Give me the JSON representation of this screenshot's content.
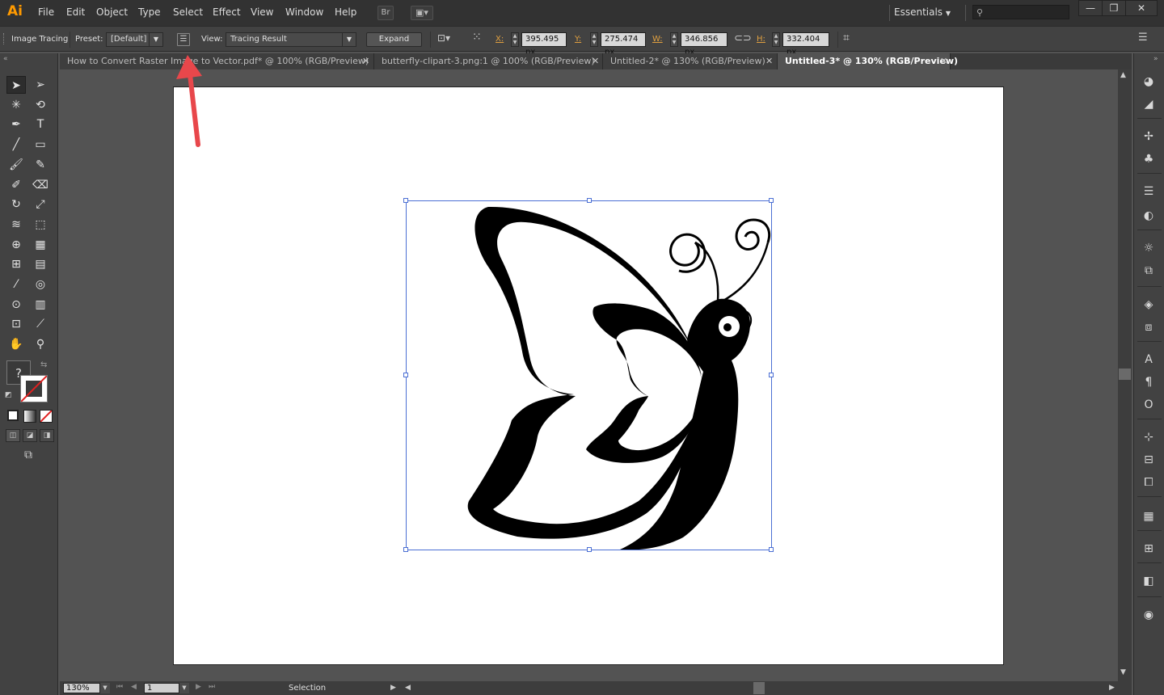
{
  "app": {
    "logo": "Ai"
  },
  "menu": [
    "File",
    "Edit",
    "Object",
    "Type",
    "Select",
    "Effect",
    "View",
    "Window",
    "Help"
  ],
  "titlebar": {
    "bridge_label": "Br",
    "workspace": "Essentials",
    "search_placeholder": "",
    "minimize": "—",
    "restore": "❐",
    "close": "✕"
  },
  "control": {
    "panel_label": "Image Tracing",
    "preset_label": "Preset:",
    "preset_value": "[Default]",
    "view_label": "View:",
    "view_value": "Tracing Result",
    "expand_label": "Expand",
    "x_label": "X:",
    "x_value": "395.495 px",
    "y_label": "Y:",
    "y_value": "275.474 px",
    "w_label": "W:",
    "w_value": "346.856 px",
    "h_label": "H:",
    "h_value": "332.404 px"
  },
  "tabs": [
    {
      "label": "How to Convert Raster Image to Vector.pdf* @ 100% (RGB/Preview)",
      "active": false
    },
    {
      "label": "butterfly-clipart-3.png:1 @ 100% (RGB/Preview)",
      "active": false
    },
    {
      "label": "Untitled-2* @ 130% (RGB/Preview)",
      "active": false
    },
    {
      "label": "Untitled-3* @ 130% (RGB/Preview)",
      "active": true
    }
  ],
  "tab_close": "✕",
  "tools": [
    {
      "name": "selection-tool",
      "glyph": "➤"
    },
    {
      "name": "direct-selection-tool",
      "glyph": "➢"
    },
    {
      "name": "magic-wand-tool",
      "glyph": "✳"
    },
    {
      "name": "lasso-tool",
      "glyph": "⟲"
    },
    {
      "name": "pen-tool",
      "glyph": "✒"
    },
    {
      "name": "type-tool",
      "glyph": "T"
    },
    {
      "name": "line-tool",
      "glyph": "╱"
    },
    {
      "name": "rectangle-tool",
      "glyph": "▭"
    },
    {
      "name": "paintbrush-tool",
      "glyph": "🖌"
    },
    {
      "name": "pencil-tool",
      "glyph": "✎"
    },
    {
      "name": "blob-brush-tool",
      "glyph": "✐"
    },
    {
      "name": "eraser-tool",
      "glyph": "⌫"
    },
    {
      "name": "rotate-tool",
      "glyph": "↻"
    },
    {
      "name": "scale-tool",
      "glyph": "⤢"
    },
    {
      "name": "warp-tool",
      "glyph": "≋"
    },
    {
      "name": "free-transform-tool",
      "glyph": "⬚"
    },
    {
      "name": "shape-builder-tool",
      "glyph": "⊕"
    },
    {
      "name": "perspective-grid-tool",
      "glyph": "▦"
    },
    {
      "name": "mesh-tool",
      "glyph": "⊞"
    },
    {
      "name": "gradient-tool",
      "glyph": "▤"
    },
    {
      "name": "eyedropper-tool",
      "glyph": "⁄"
    },
    {
      "name": "blend-tool",
      "glyph": "◎"
    },
    {
      "name": "symbol-sprayer-tool",
      "glyph": "⊙"
    },
    {
      "name": "column-graph-tool",
      "glyph": "▥"
    },
    {
      "name": "artboard-tool",
      "glyph": "⊡"
    },
    {
      "name": "slice-tool",
      "glyph": "⟋"
    },
    {
      "name": "hand-tool",
      "glyph": "✋"
    },
    {
      "name": "zoom-tool",
      "glyph": "⚲"
    }
  ],
  "fill_unknown": "?",
  "right_panels": [
    {
      "name": "color-panel-icon",
      "glyph": "◕"
    },
    {
      "name": "color-guide-icon",
      "glyph": "◢"
    },
    {
      "name": "brushes-panel-icon",
      "glyph": "✢"
    },
    {
      "name": "symbols-panel-icon",
      "glyph": "♣"
    },
    {
      "name": "stroke-panel-icon",
      "glyph": "☰"
    },
    {
      "name": "gradient-panel-icon",
      "glyph": "◐"
    },
    {
      "name": "appearance-panel-icon",
      "glyph": "☼"
    },
    {
      "name": "graphic-styles-icon",
      "glyph": "⧉"
    },
    {
      "name": "layers-panel-icon",
      "glyph": "◈"
    },
    {
      "name": "artboards-panel-icon",
      "glyph": "⧈"
    },
    {
      "name": "character-panel-icon",
      "glyph": "A"
    },
    {
      "name": "paragraph-panel-icon",
      "glyph": "¶"
    },
    {
      "name": "opentype-panel-icon",
      "glyph": "O"
    },
    {
      "name": "transform-panel-icon",
      "glyph": "⊹"
    },
    {
      "name": "align-panel-icon",
      "glyph": "⊟"
    },
    {
      "name": "pathfinder-panel-icon",
      "glyph": "⧠"
    },
    {
      "name": "swatches-panel-icon",
      "glyph": "▦"
    },
    {
      "name": "links-panel-icon",
      "glyph": "⊞"
    },
    {
      "name": "transparency-panel-icon",
      "glyph": "◧"
    },
    {
      "name": "image-trace-panel-icon",
      "glyph": "◉"
    }
  ],
  "status": {
    "zoom": "130%",
    "artboard_number": "1",
    "current_tool": "Selection"
  },
  "colors": {
    "accent_logo": "#ff9a00",
    "selection_bbox": "#4b6fd4",
    "annotation_arrow": "#e8474b"
  }
}
